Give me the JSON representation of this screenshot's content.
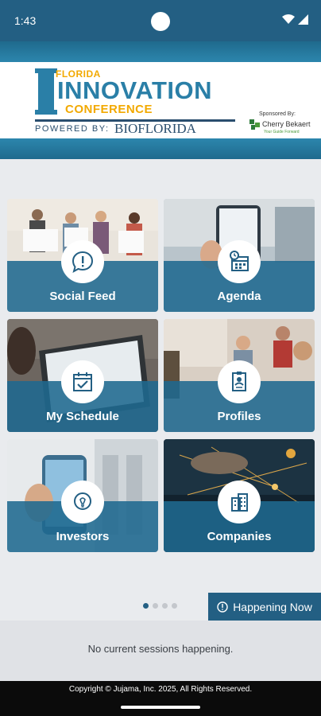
{
  "status_bar": {
    "time": "1:43"
  },
  "header": {
    "logo": {
      "florida": "FLORIDA",
      "innovation": "INNOVATION",
      "conference": "CONFERENCE",
      "powered_by": "POWERED BY:",
      "bioflorida": "BIOFLORIDA"
    },
    "sponsor": {
      "label": "Sponsored By:",
      "name": "Cherry Bekaert",
      "tagline": "Your Guide Forward"
    }
  },
  "tiles": [
    {
      "label": "Social Feed",
      "icon": "speech-bubble-icon"
    },
    {
      "label": "Agenda",
      "icon": "calendar-clock-icon"
    },
    {
      "label": "My Schedule",
      "icon": "calendar-check-icon"
    },
    {
      "label": "Profiles",
      "icon": "id-card-icon"
    },
    {
      "label": "Investors",
      "icon": "lightbulb-icon"
    },
    {
      "label": "Companies",
      "icon": "buildings-icon"
    }
  ],
  "pager": {
    "pages": 4,
    "active": 1
  },
  "happening_now": {
    "label": "Happening Now"
  },
  "sessions": {
    "empty_text": "No current sessions happening."
  },
  "footer": {
    "copyright": "Copyright © Jujama, Inc. 2025, All Rights Reserved."
  },
  "colors": {
    "primary": "#235f83",
    "teal": "#2a7fa7",
    "gold": "#f2a900",
    "overlay": "#1f698f"
  }
}
